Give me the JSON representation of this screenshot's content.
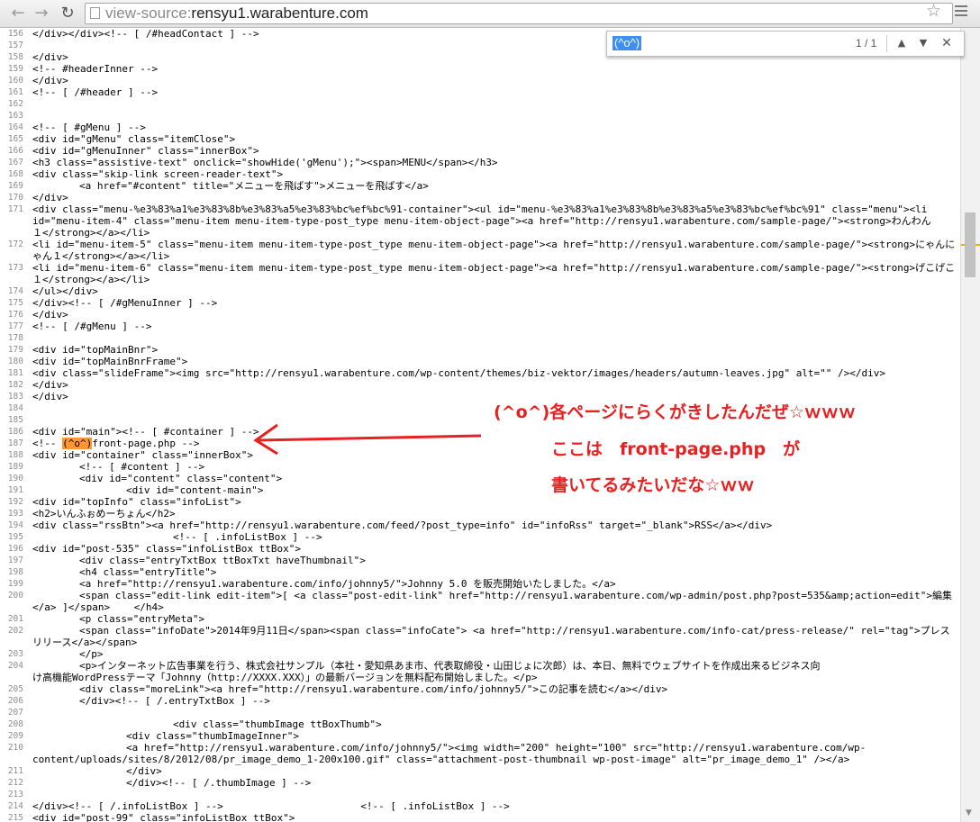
{
  "browser": {
    "back_icon": "back-arrow-icon",
    "forward_icon": "forward-arrow-icon",
    "reload_icon": "reload-icon",
    "address_scheme": "view-source:",
    "address_host": "rensyu1.warabenture.com",
    "bookmark_icon": "star-icon",
    "menu_icon": "hamburger-menu-icon"
  },
  "find": {
    "query": "(^o^)",
    "count": "1 / 1",
    "prev_icon": "chevron-up-icon",
    "next_icon": "chevron-down-icon",
    "close_icon": "close-icon"
  },
  "annotation": {
    "line1": "(^o^)各ページにらくがきしたんだぜ☆ｗｗｗ",
    "line2": "ここは　front-page.php　が",
    "line3": "書いてるみたいだな☆ｗｗ",
    "color": "#e82020"
  },
  "highlight_color": "#ff9632",
  "lines": [
    {
      "n": "156",
      "t": "</div></div><!-- [ /#headContact ] -->",
      "i": 0
    },
    {
      "n": "157",
      "t": "",
      "i": 0
    },
    {
      "n": "158",
      "t": "</div>",
      "i": 0
    },
    {
      "n": "159",
      "t": "<!-- #headerInner -->",
      "i": 0
    },
    {
      "n": "160",
      "t": "</div>",
      "i": 0
    },
    {
      "n": "161",
      "t": "<!-- [ /#header ] -->",
      "i": 0
    },
    {
      "n": "162",
      "t": "",
      "i": 0
    },
    {
      "n": "163",
      "t": "",
      "i": 0
    },
    {
      "n": "164",
      "t": "<!-- [ #gMenu ] -->",
      "i": 0
    },
    {
      "n": "165",
      "t": "<div id=\"gMenu\" class=\"itemClose\">",
      "i": 0
    },
    {
      "n": "166",
      "t": "<div id=\"gMenuInner\" class=\"innerBox\">",
      "i": 0
    },
    {
      "n": "167",
      "t": "<h3 class=\"assistive-text\" onclick=\"showHide('gMenu');\"><span>MENU</span></h3>",
      "i": 0
    },
    {
      "n": "168",
      "t": "<div class=\"skip-link screen-reader-text\">",
      "i": 0
    },
    {
      "n": "169",
      "t": "<a href=\"#content\" title=\"メニューを飛ばす\">メニューを飛ばす</a>",
      "i": 1
    },
    {
      "n": "170",
      "t": "</div>",
      "i": 0
    },
    {
      "n": "171",
      "t": "<div class=\"menu-%e3%83%a1%e3%83%8b%e3%83%a5%e3%83%bc%ef%bc%91-container\"><ul id=\"menu-%e3%83%a1%e3%83%8b%e3%83%a5%e3%83%bc%ef%bc%91\" class=\"menu\"><li",
      "i": 0
    },
    {
      "n": "",
      "t": "id=\"menu-item-4\" class=\"menu-item menu-item-type-post_type menu-item-object-page\"><a href=\"http://rensyu1.warabenture.com/sample-page/\"><strong>わんわん",
      "i": 0
    },
    {
      "n": "",
      "t": "１</strong></a></li>",
      "i": 0
    },
    {
      "n": "172",
      "t": "<li id=\"menu-item-5\" class=\"menu-item menu-item-type-post_type menu-item-object-page\"><a href=\"http://rensyu1.warabenture.com/sample-page/\"><strong>にゃんに",
      "i": 0
    },
    {
      "n": "",
      "t": "ゃん１</strong></a></li>",
      "i": 0
    },
    {
      "n": "173",
      "t": "<li id=\"menu-item-6\" class=\"menu-item menu-item-type-post_type menu-item-object-page\"><a href=\"http://rensyu1.warabenture.com/sample-page/\"><strong>げこげこ",
      "i": 0
    },
    {
      "n": "",
      "t": "１</strong></a></li>",
      "i": 0
    },
    {
      "n": "174",
      "t": "</ul></div>",
      "i": 0
    },
    {
      "n": "175",
      "t": "</div><!-- [ /#gMenuInner ] -->",
      "i": 0
    },
    {
      "n": "176",
      "t": "</div>",
      "i": 0
    },
    {
      "n": "177",
      "t": "<!-- [ /#gMenu ] -->",
      "i": 0
    },
    {
      "n": "178",
      "t": "",
      "i": 0
    },
    {
      "n": "179",
      "t": "<div id=\"topMainBnr\">",
      "i": 0
    },
    {
      "n": "180",
      "t": "<div id=\"topMainBnrFrame\">",
      "i": 0
    },
    {
      "n": "181",
      "t": "<div class=\"slideFrame\"><img src=\"http://rensyu1.warabenture.com/wp-content/themes/biz-vektor/images/headers/autumn-leaves.jpg\" alt=\"\" /></div>",
      "i": 0
    },
    {
      "n": "182",
      "t": "</div>",
      "i": 0
    },
    {
      "n": "183",
      "t": "</div>",
      "i": 0
    },
    {
      "n": "184",
      "t": "",
      "i": 0
    },
    {
      "n": "185",
      "t": "",
      "i": 0
    },
    {
      "n": "186",
      "t": "<div id=\"main\"><!-- [ #container ] -->",
      "i": 0
    },
    {
      "n": "187",
      "t": "<!-- (^o^)front-page.php -->",
      "i": 0
    },
    {
      "n": "188",
      "t": "<div id=\"container\" class=\"innerBox\">",
      "i": 0
    },
    {
      "n": "189",
      "t": "<!-- [ #content ] -->",
      "i": 1
    },
    {
      "n": "190",
      "t": "<div id=\"content\" class=\"content\">",
      "i": 1
    },
    {
      "n": "191",
      "t": "<div id=\"content-main\">",
      "i": 2
    },
    {
      "n": "192",
      "t": "<div id=\"topInfo\" class=\"infoList\">",
      "i": 0
    },
    {
      "n": "193",
      "t": "<h2>いんふぉめーちょん</h2>",
      "i": 0
    },
    {
      "n": "194",
      "t": "<div class=\"rssBtn\"><a href=\"http://rensyu1.warabenture.com/feed/?post_type=info\" id=\"infoRss\" target=\"_blank\">RSS</a></div>",
      "i": 0
    },
    {
      "n": "195",
      "t": "<!-- [ .infoListBox ] -->",
      "i": 3
    },
    {
      "n": "196",
      "t": "<div id=\"post-535\" class=\"infoListBox ttBox\">",
      "i": 0
    },
    {
      "n": "197",
      "t": "<div class=\"entryTxtBox ttBoxTxt haveThumbnail\">",
      "i": 1
    },
    {
      "n": "198",
      "t": "<h4 class=\"entryTitle\">",
      "i": 1
    },
    {
      "n": "199",
      "t": "<a href=\"http://rensyu1.warabenture.com/info/johnny5/\">Johnny 5.0 を販売開始いたしました。</a>",
      "i": 1
    },
    {
      "n": "200",
      "t": "<span class=\"edit-link edit-item\">[ <a class=\"post-edit-link\" href=\"http://rensyu1.warabenture.com/wp-admin/post.php?post=535&amp;action=edit\">編集",
      "i": 1
    },
    {
      "n": "",
      "t": "</a> ]</span>    </h4>",
      "i": 0
    },
    {
      "n": "201",
      "t": "<p class=\"entryMeta\">",
      "i": 1
    },
    {
      "n": "202",
      "t": "<span class=\"infoDate\">2014年9月11日</span><span class=\"infoCate\"> <a href=\"http://rensyu1.warabenture.com/info-cat/press-release/\" rel=\"tag\">プレス",
      "i": 1
    },
    {
      "n": "",
      "t": "リリース</a></span>",
      "i": 0
    },
    {
      "n": "203",
      "t": "</p>",
      "i": 1
    },
    {
      "n": "204",
      "t": "<p>インターネット広告事業を行う、株式会社サンプル（本社・愛知県あま市、代表取締役・山田じょに次郎）は、本日、無料でウェブサイトを作成出来るビジネス向",
      "i": 1
    },
    {
      "n": "",
      "t": "け高機能WordPressテーマ「Johnny（http://XXXX.XXX）」の最新バージョンを無料配布開始しました。</p>",
      "i": 0
    },
    {
      "n": "205",
      "t": "<div class=\"moreLink\"><a href=\"http://rensyu1.warabenture.com/info/johnny5/\">この記事を読む</a></div>",
      "i": 1
    },
    {
      "n": "206",
      "t": "</div><!-- [ /.entryTxtBox ] -->",
      "i": 1
    },
    {
      "n": "207",
      "t": "",
      "i": 0
    },
    {
      "n": "208",
      "t": "<div class=\"thumbImage ttBoxThumb\">",
      "i": 3
    },
    {
      "n": "209",
      "t": "<div class=\"thumbImageInner\">",
      "i": 2
    },
    {
      "n": "210",
      "t": "<a href=\"http://rensyu1.warabenture.com/info/johnny5/\"><img width=\"200\" height=\"100\" src=\"http://rensyu1.warabenture.com/wp-",
      "i": 2
    },
    {
      "n": "",
      "t": "content/uploads/sites/8/2012/08/pr_image_demo_1-200x100.gif\" class=\"attachment-post-thumbnail wp-post-image\" alt=\"pr_image_demo_1\" /></a>",
      "i": 0
    },
    {
      "n": "211",
      "t": "</div>",
      "i": 2
    },
    {
      "n": "212",
      "t": "</div><!-- [ /.thumbImage ] -->",
      "i": 2
    },
    {
      "n": "213",
      "t": "",
      "i": 0
    },
    {
      "n": "214",
      "t": "</div><!-- [ /.infoListBox ] -->                       <!-- [ .infoListBox ] -->",
      "i": 0
    },
    {
      "n": "215",
      "t": "<div id=\"post-99\" class=\"infoListBox ttBox\">",
      "i": 0
    }
  ]
}
